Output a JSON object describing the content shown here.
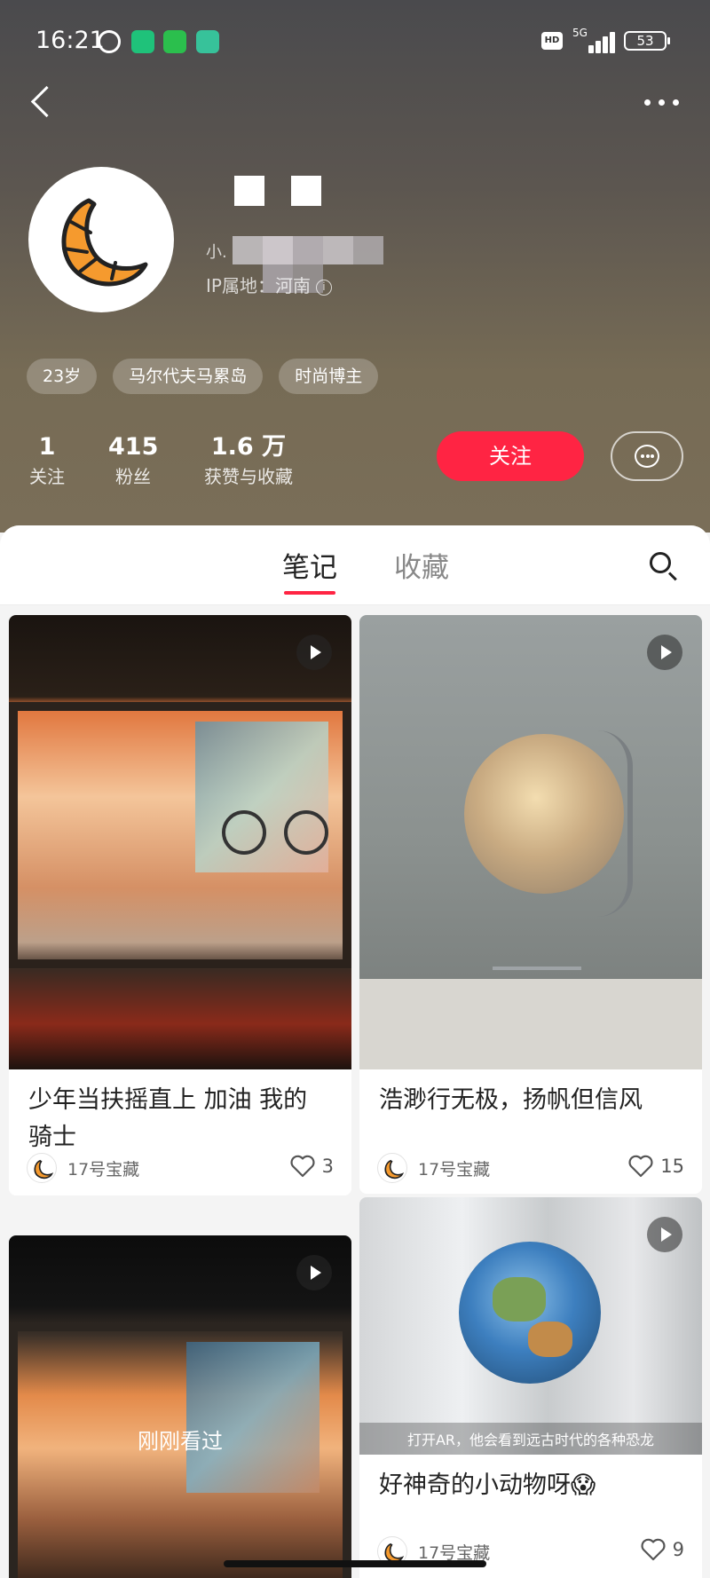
{
  "status_bar": {
    "time": "16:21",
    "network": "5G",
    "hd_label": "HD",
    "battery": "53"
  },
  "profile": {
    "user_id_prefix": "小.",
    "ip_location": "IP属地：河南",
    "tags": [
      "23岁",
      "马尔代夫马累岛",
      "时尚博主"
    ],
    "stats": [
      {
        "value": "1",
        "label": "关注"
      },
      {
        "value": "415",
        "label": "粉丝"
      },
      {
        "value": "1.6 万",
        "label": "获赞与收藏"
      }
    ],
    "follow_label": "关注"
  },
  "tabs": {
    "notes": "笔记",
    "collections": "收藏"
  },
  "notes": [
    {
      "title": "少年当扶摇直上 加油 我的骑士",
      "author": "17号宝藏",
      "likes": "3",
      "has_video": true
    },
    {
      "title": "浩渺行无极，扬帆但信风",
      "author": "17号宝藏",
      "likes": "15",
      "has_video": true
    },
    {
      "title": "",
      "author": "",
      "likes": "",
      "has_video": true,
      "overlay_text": "刚刚看过"
    },
    {
      "title": "好神奇的小动物呀😱",
      "author": "17号宝藏",
      "likes": "9",
      "has_video": true,
      "caption": "打开AR，他会看到远古时代的各种恐龙"
    }
  ],
  "colors": {
    "accent": "#ff2443",
    "header_top": "#4a4a4d",
    "header_bottom": "#7a6e58"
  }
}
